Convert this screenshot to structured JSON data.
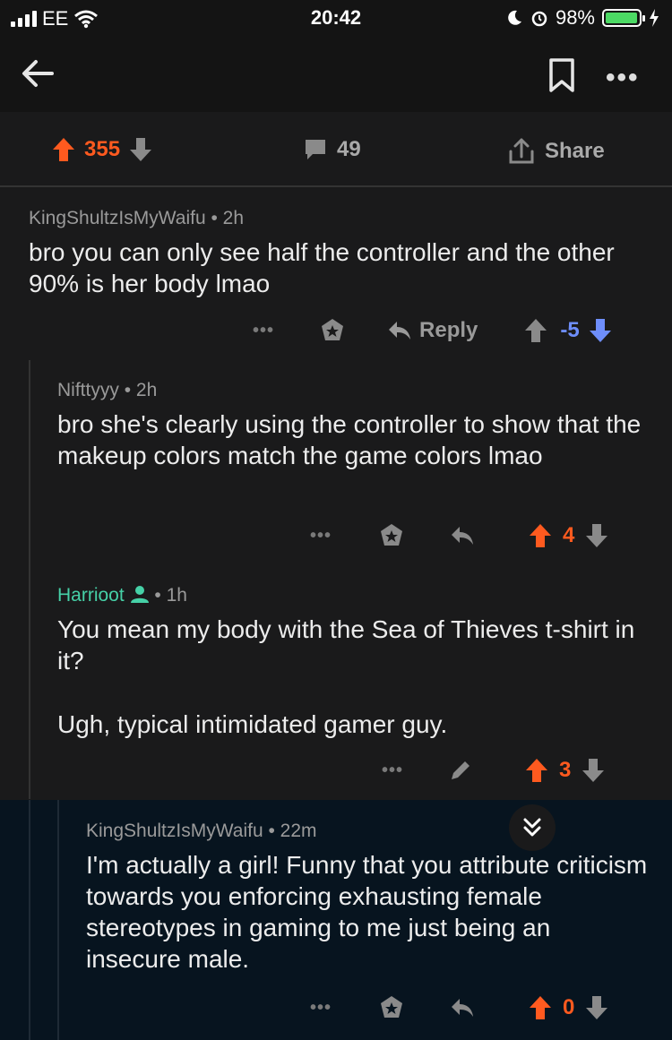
{
  "status_bar": {
    "carrier": "EE",
    "time": "20:42",
    "battery": "98%"
  },
  "post_actions": {
    "score": "355",
    "comment_count": "49",
    "share_label": "Share"
  },
  "comments": [
    {
      "username": "KingShultzIsMyWaifu",
      "age": "2h",
      "text": "bro you can only see half the controller and the other 90% is her body lmao",
      "more_label": "•••",
      "reply_label": "Reply",
      "score": "-5",
      "vote_state": "downvoted"
    },
    {
      "username": "Nifttyyy",
      "age": "2h",
      "text": "bro she's clearly using the controller to show that the makeup colors match the game colors lmao",
      "more_label": "•••",
      "score": "4",
      "vote_state": "upvoted"
    },
    {
      "username": "Harrioot",
      "age": "1h",
      "text_line1": "You mean my body with the Sea of Thieves t-shirt in it?",
      "text_line2": "Ugh, typical intimidated gamer guy.",
      "more_label": "•••",
      "score": "3",
      "vote_state": "upvoted"
    },
    {
      "username": "KingShultzIsMyWaifu",
      "age": "22m",
      "text": "I'm actually a girl! Funny that you attribute criticism towards you enforcing exhausting female stereotypes in gaming to me just being an insecure male.",
      "more_label": "•••",
      "score": "0",
      "vote_state": "upvoted"
    }
  ],
  "separator": "•",
  "colors": {
    "upvote": "#ff5a1f",
    "downvote": "#6e8efb",
    "highlight_bg": "#07141f",
    "op_green": "#46d1a7"
  }
}
